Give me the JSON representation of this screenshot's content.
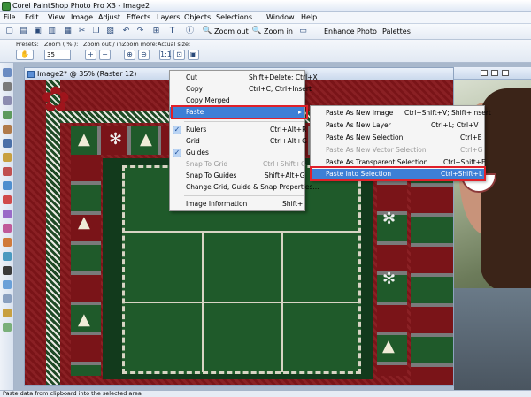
{
  "app": {
    "title": "Corel PaintShop Photo Pro X3 - Image2"
  },
  "menubar": [
    "File",
    "Edit",
    "View",
    "Image",
    "Adjust",
    "Effects",
    "Layers",
    "Objects",
    "Selections",
    "Window",
    "Help"
  ],
  "toolbar": {
    "zoom_out": "Zoom out",
    "zoom_in": "Zoom in",
    "enhance_photo": "Enhance Photo",
    "palettes": "Palettes"
  },
  "presets": {
    "presets_label": "Presets:",
    "zoom_label": "Zoom ( % ):",
    "zoom_value": "35",
    "zoom_inout_label": "Zoom out / in:",
    "zoom_more_label": "Zoom more:",
    "actual_size_label": "Actual size:",
    "actual_size_btn": "1:1"
  },
  "document": {
    "title": "Image2* @  35% (Raster 12)"
  },
  "context_menu": {
    "items": [
      {
        "label": "Cut",
        "shortcut": "Shift+Delete; Ctrl+X"
      },
      {
        "label": "Copy",
        "shortcut": "Ctrl+C; Ctrl+Insert"
      },
      {
        "label": "Copy Merged",
        "shortcut": ""
      },
      {
        "label": "Paste",
        "shortcut": ""
      },
      {
        "label": "Rulers",
        "shortcut": "Ctrl+Alt+R"
      },
      {
        "label": "Grid",
        "shortcut": "Ctrl+Alt+G"
      },
      {
        "label": "Guides",
        "shortcut": ""
      },
      {
        "label": "Snap To Grid",
        "shortcut": "Ctrl+Shift+G"
      },
      {
        "label": "Snap To Guides",
        "shortcut": "Shift+Alt+G"
      },
      {
        "label": "Change Grid, Guide & Snap Properties...",
        "shortcut": ""
      },
      {
        "label": "Image Information",
        "shortcut": "Shift+I"
      }
    ]
  },
  "submenu": {
    "items": [
      {
        "label": "Paste As New Image",
        "shortcut": "Ctrl+Shift+V; Shift+Insert"
      },
      {
        "label": "Paste As New Layer",
        "shortcut": "Ctrl+L; Ctrl+V"
      },
      {
        "label": "Paste As New Selection",
        "shortcut": "Ctrl+E"
      },
      {
        "label": "Paste As New Vector Selection",
        "shortcut": "Ctrl+G"
      },
      {
        "label": "Paste As Transparent Selection",
        "shortcut": "Ctrl+Shift+E"
      },
      {
        "label": "Paste Into Selection",
        "shortcut": "Ctrl+Shift+L"
      }
    ]
  },
  "status": {
    "text": "Paste data from clipboard into the selected area"
  },
  "colors": {
    "highlight": "#3d7fd6",
    "callout": "#e0202a",
    "frame_red": "#7a1418",
    "frame_green": "#1f4a26"
  }
}
